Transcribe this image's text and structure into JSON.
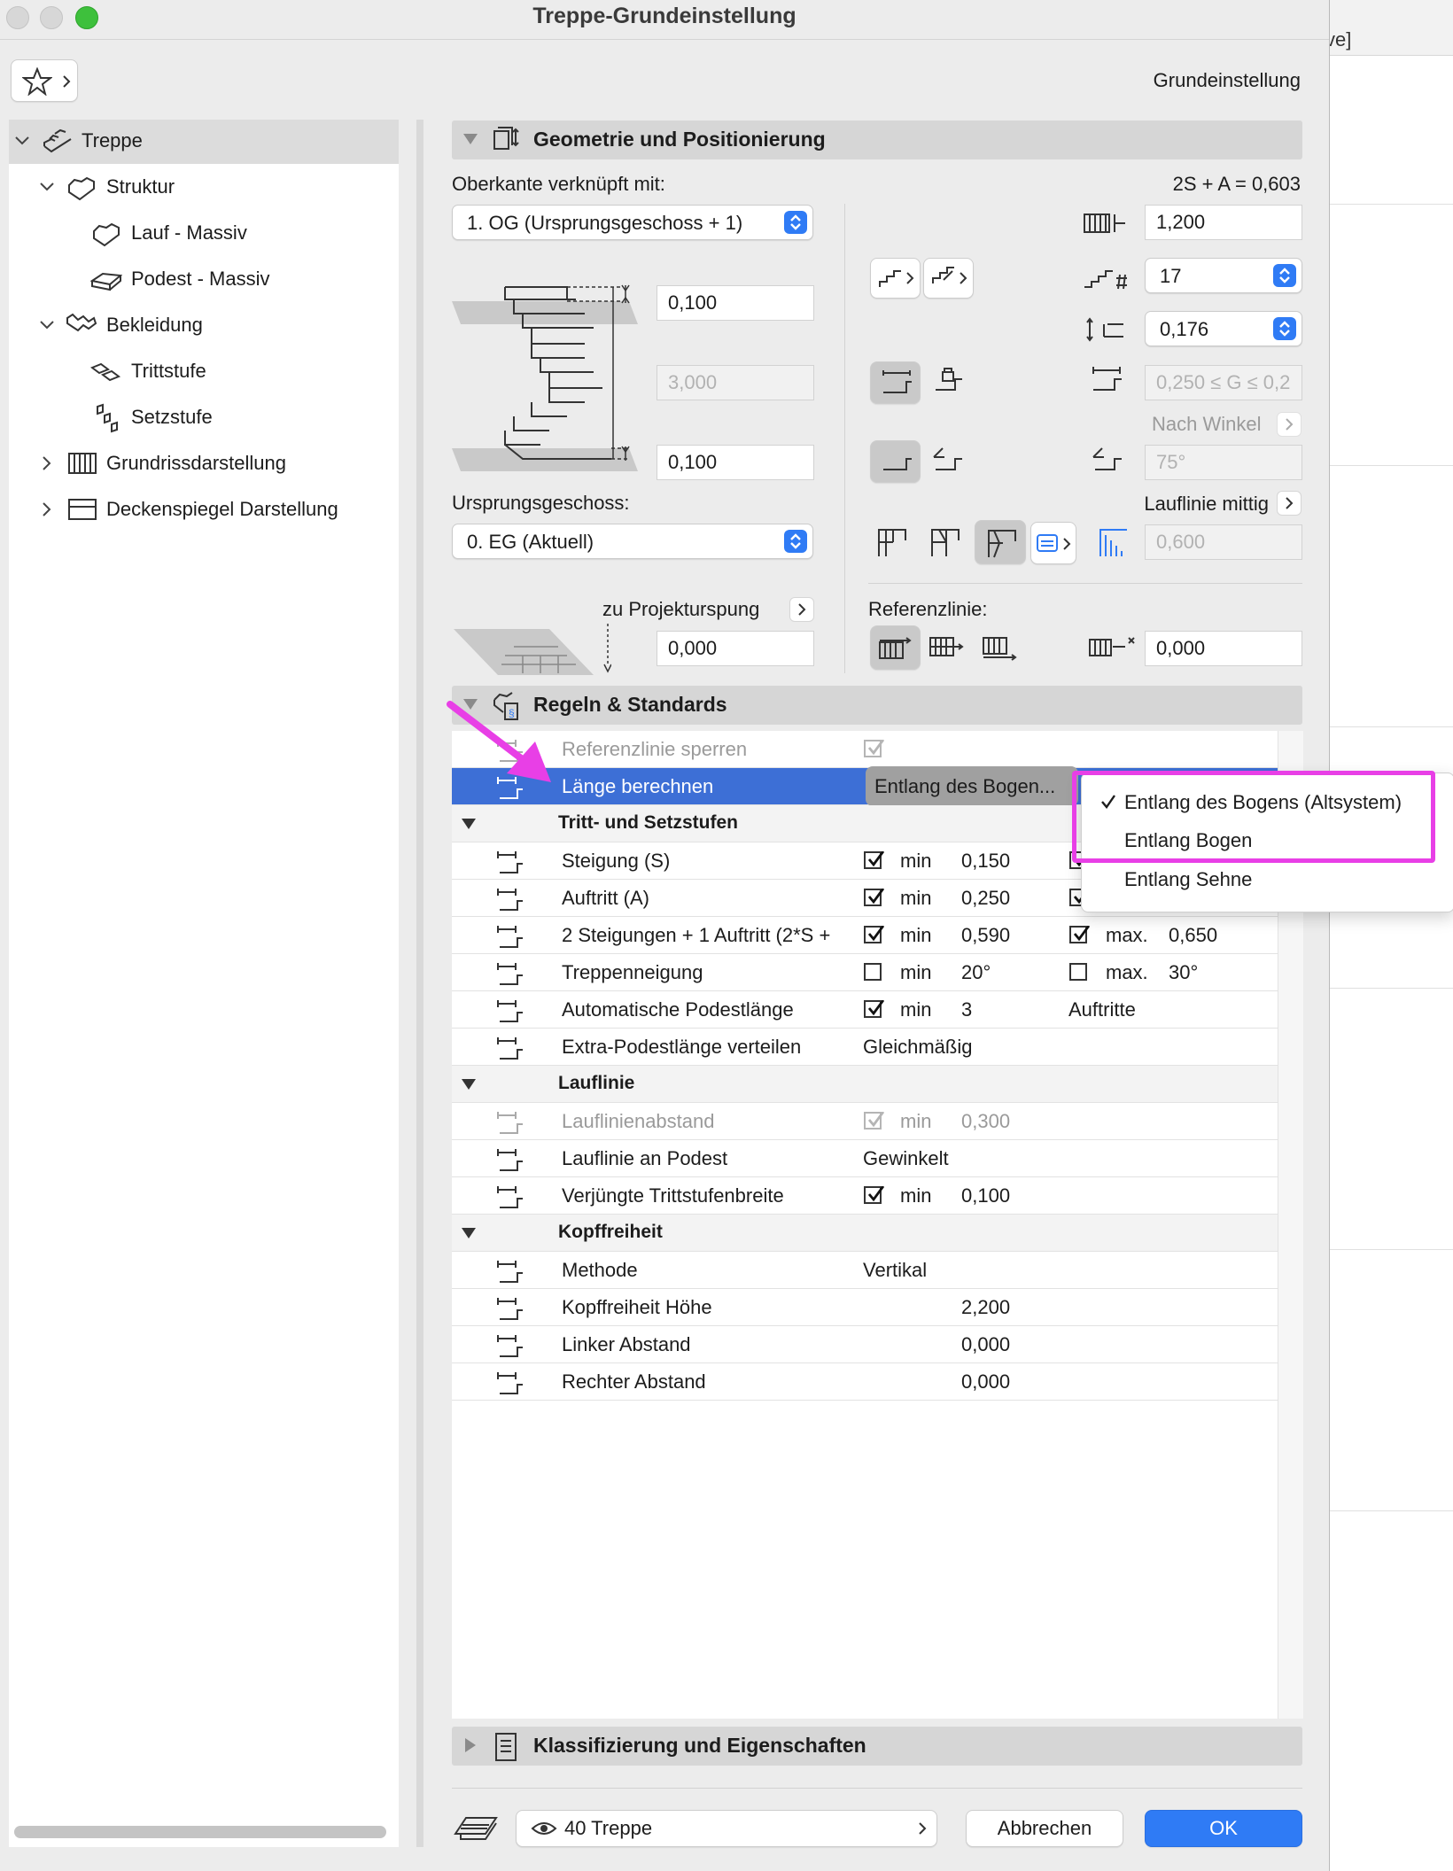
{
  "window": {
    "title": "Treppe-Grundeinstellung",
    "preset_label": "Grundeinstellung"
  },
  "background_window": {
    "title_fragment": "ve]"
  },
  "sidebar": {
    "items": [
      {
        "label": "Treppe",
        "icon": "stair-icon",
        "expanded": true,
        "selected": true
      },
      {
        "label": "Struktur",
        "icon": "structure-icon",
        "expanded": true
      },
      {
        "label": "Lauf - Massiv",
        "icon": "flight-icon"
      },
      {
        "label": "Podest - Massiv",
        "icon": "landing-icon"
      },
      {
        "label": "Bekleidung",
        "icon": "finish-icon",
        "expanded": true
      },
      {
        "label": "Trittstufe",
        "icon": "tread-icon"
      },
      {
        "label": "Setzstufe",
        "icon": "riser-icon"
      },
      {
        "label": "Grundrissdarstellung",
        "icon": "floorplan-icon",
        "expanded": false
      },
      {
        "label": "Deckenspiegel Darstellung",
        "icon": "ceiling-plan-icon",
        "expanded": false
      }
    ]
  },
  "geometry": {
    "title": "Geometrie und Positionierung",
    "top_linked_label": "Oberkante verknüpft mit:",
    "top_linked_value": "1. OG (Ursprungsgeschoss + 1)",
    "formula": "2S + A = 0,603",
    "top_offset": "0,100",
    "height": "3,000",
    "bottom_offset": "0,100",
    "home_story_label": "Ursprungsgeschoss:",
    "home_story_value": "0. EG (Aktuell)",
    "project_origin_label": "zu Projekturspung",
    "project_origin_value": "0,000",
    "width": "1,200",
    "risers": "17",
    "riser_height": "0,176",
    "tread_range": "0,250 ≤ G ≤ 0,2",
    "angle_label": "Nach Winkel",
    "angle_value": "75°",
    "walkline_label": "Lauflinie mittig",
    "walkline_value": "0,600",
    "reference_label": "Referenzlinie:",
    "reference_offset": "0,000"
  },
  "rules": {
    "title": "Regeln & Standards",
    "rows": [
      {
        "type": "row",
        "name": "Referenzlinie sperren",
        "dim": true,
        "check": "dim"
      },
      {
        "type": "selected",
        "name": "Länge berechnen",
        "value": "Entlang des Bogen..."
      },
      {
        "type": "group",
        "name": "Tritt- und Setzstufen"
      },
      {
        "type": "row",
        "name": "Steigung (S)",
        "check": "on",
        "min_label": "min",
        "min": "0,150",
        "check2": "on"
      },
      {
        "type": "row",
        "name": "Auftritt (A)",
        "check": "on",
        "min_label": "min",
        "min": "0,250",
        "check2": "on"
      },
      {
        "type": "row",
        "name": "2 Steigungen + 1 Auftritt (2*S +",
        "check": "on",
        "min_label": "min",
        "min": "0,590",
        "check2": "on",
        "max_label": "max.",
        "max": "0,650"
      },
      {
        "type": "row",
        "name": "Treppenneigung",
        "check": "off",
        "min_label": "min",
        "min": "20°",
        "check2": "off",
        "max_label": "max.",
        "max": "30°"
      },
      {
        "type": "row",
        "name": "Automatische Podestlänge",
        "check": "on",
        "min_label": "min",
        "min": "3",
        "extra": "Auftritte"
      },
      {
        "type": "row",
        "name": "Extra-Podestlänge verteilen",
        "value": "Gleichmäßig"
      },
      {
        "type": "group",
        "name": "Lauflinie"
      },
      {
        "type": "row",
        "name": "Lauflinienabstand",
        "dim": true,
        "check": "dim",
        "min_label": "min",
        "min": "0,300"
      },
      {
        "type": "row",
        "name": "Lauflinie an Podest",
        "value": "Gewinkelt"
      },
      {
        "type": "row",
        "name": "Verjüngte Trittstufenbreite",
        "check": "on",
        "min_label": "min",
        "min": "0,100"
      },
      {
        "type": "group",
        "name": "Kopffreiheit"
      },
      {
        "type": "row",
        "name": "Methode",
        "value": "Vertikal"
      },
      {
        "type": "row",
        "name": "Kopffreiheit Höhe",
        "min": "2,200"
      },
      {
        "type": "row",
        "name": "Linker Abstand",
        "min": "0,000"
      },
      {
        "type": "row",
        "name": "Rechter Abstand",
        "min": "0,000"
      }
    ]
  },
  "menu": {
    "items": [
      {
        "label": "Entlang des Bogens (Altsystem)",
        "checked": true
      },
      {
        "label": "Entlang Bogen",
        "checked": false
      },
      {
        "label": "Entlang Sehne",
        "checked": false
      }
    ]
  },
  "classification": {
    "title": "Klassifizierung und Eigenschaften"
  },
  "footer": {
    "layer": "40 Treppe",
    "cancel": "Abbrechen",
    "ok": "OK"
  },
  "colors": {
    "accent": "#2f7bf5",
    "selection": "#3d6fd6",
    "highlight": "#e83fe6"
  }
}
